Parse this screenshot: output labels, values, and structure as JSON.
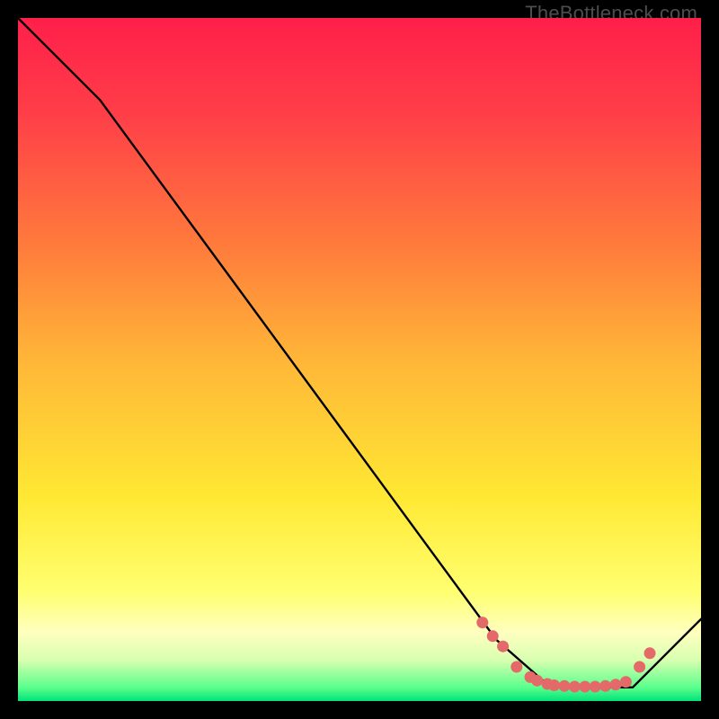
{
  "watermark": "TheBottleneck.com",
  "chart_data": {
    "type": "line",
    "title": "",
    "xlabel": "",
    "ylabel": "",
    "xlim": [
      0,
      100
    ],
    "ylim": [
      0,
      100
    ],
    "series": [
      {
        "name": "bottleneck-curve",
        "x": [
          0,
          12,
          70,
          78,
          90,
          100
        ],
        "y": [
          100,
          88,
          9,
          2,
          2,
          12
        ]
      }
    ],
    "markers": {
      "name": "highlight-points",
      "color": "#e46a6a",
      "x": [
        68,
        69.5,
        71,
        73,
        75,
        76,
        77.5,
        78.5,
        80,
        81.5,
        83,
        84.5,
        86,
        87.5,
        89,
        91,
        92.5
      ],
      "y": [
        11.5,
        9.5,
        8,
        5,
        3.5,
        3,
        2.5,
        2.3,
        2.2,
        2.1,
        2.1,
        2.1,
        2.2,
        2.4,
        2.8,
        5,
        7
      ]
    }
  }
}
